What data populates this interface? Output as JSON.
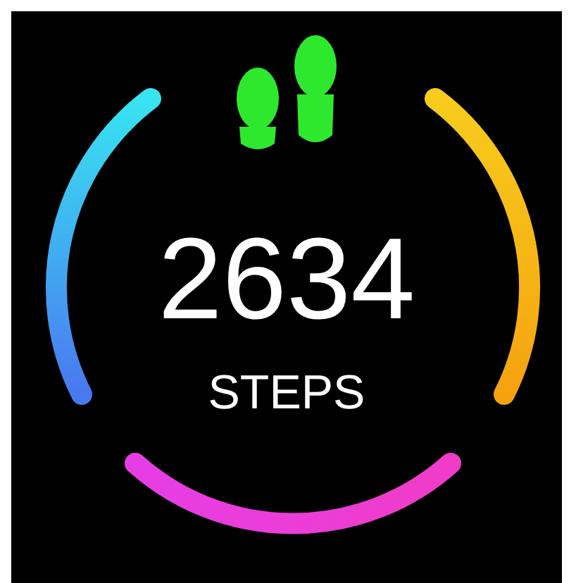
{
  "steps": {
    "value": "2634",
    "label": "STEPS"
  }
}
